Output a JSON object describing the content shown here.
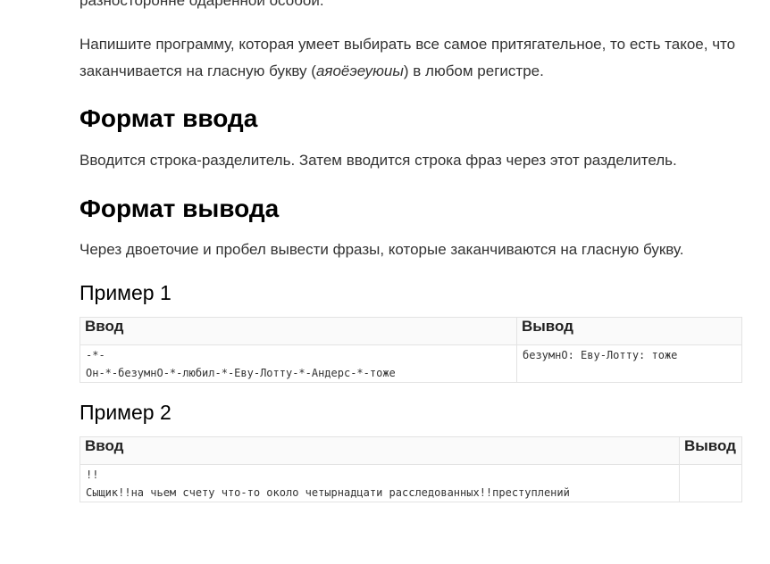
{
  "statement": {
    "cut_line": "разносторонне одарённой особой.",
    "intro_before": "Напишите программу, которая умеет выбирать все самое притягательное, то есть такое, что заканчивается на гласную букву (",
    "vowels": "аяоёэеуюиы",
    "intro_after": ") в любом регистре."
  },
  "input_format": {
    "heading": "Формат ввода",
    "text": "Вводится строка-разделитель. Затем вводится строка фраз через этот разделитель."
  },
  "output_format": {
    "heading": "Формат вывода",
    "text": "Через двоеточие и пробел вывести фразы, которые заканчиваются на гласную букву."
  },
  "examples": [
    {
      "title": "Пример 1",
      "input_header": "Ввод",
      "output_header": "Вывод",
      "input_lines": [
        "-*-",
        "Он-*-безумнО-*-любил-*-Еву-Лотту-*-Андерс-*-тоже"
      ],
      "output_lines": [
        "безумнО: Еву-Лотту: тоже"
      ]
    },
    {
      "title": "Пример 2",
      "input_header": "Ввод",
      "output_header": "Вывод",
      "input_lines": [
        "!!",
        "Сыщик!!на чьем счету что-то около четырнадцати расследованных!!преступлений"
      ],
      "output_lines": []
    }
  ]
}
